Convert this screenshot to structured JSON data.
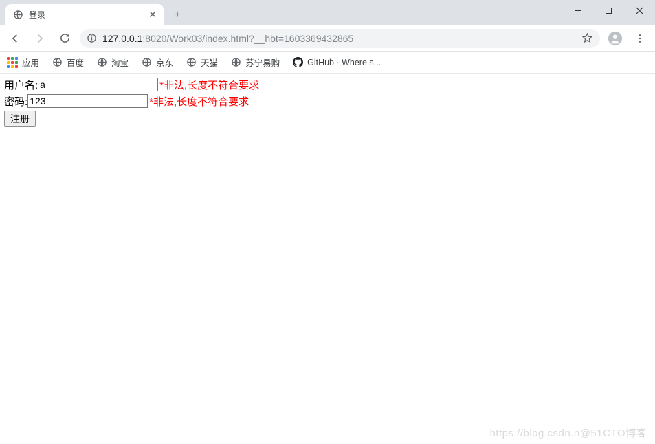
{
  "window": {
    "tab_title": "登录"
  },
  "toolbar": {
    "url_host": "127.0.0.1",
    "url_port": ":8020",
    "url_path": "/Work03/index.html?__hbt=1603369432865"
  },
  "bookmarks": {
    "apps_label": "应用",
    "items": [
      {
        "label": "百度"
      },
      {
        "label": "淘宝"
      },
      {
        "label": "京东"
      },
      {
        "label": "天猫"
      },
      {
        "label": "苏宁易购"
      },
      {
        "label": "GitHub · Where s..."
      }
    ]
  },
  "form": {
    "username_label": "用户名:",
    "username_value": "a",
    "username_error": "*非法,长度不符合要求",
    "password_label": "密码:",
    "password_value": "123",
    "password_error": "*非法,长度不符合要求",
    "submit_label": "注册"
  },
  "watermark": "https://blog.csdn.n@51CTO博客"
}
